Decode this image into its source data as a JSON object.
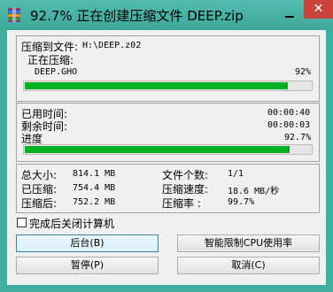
{
  "window": {
    "title": "92.7% 正在创建压缩文件 DEEP.zip",
    "close_glyph": "✕"
  },
  "file_group": {
    "compress_to_label": "压缩到文件:",
    "compress_to_value": "H:\\DEEP.z02",
    "compressing_label": "正在压缩:",
    "current_file": "DEEP.GHO",
    "file_percent": "92%",
    "file_progress": 0.92
  },
  "time_group": {
    "elapsed_label": "已用时间:",
    "elapsed_value": "00:00:40",
    "remaining_label": "剩余时间:",
    "remaining_value": "00:00:03",
    "progress_label": "进度",
    "progress_value": "92.7%",
    "overall_progress": 0.927
  },
  "stats": {
    "total_size_label": "总大小:",
    "total_size_value": "814.1 MB",
    "compressed_label": "已压缩:",
    "compressed_value": "754.4 MB",
    "after_label": "压缩后:",
    "after_value": "752.2 MB",
    "file_count_label": "文件个数:",
    "file_count_value": "1/1",
    "speed_label": "压缩速度:",
    "speed_value": "18.6 MB/秒",
    "ratio_label": "压缩率   :",
    "ratio_value": "99.7%"
  },
  "options": {
    "shutdown_label": "完成后关闭计算机",
    "shutdown_checked": false
  },
  "buttons": {
    "background": "后台(B)",
    "smart_cpu": "智能限制CPU使用率",
    "pause": "暂停(P)",
    "cancel": "取消(C)"
  },
  "colors": {
    "progress": "#06b025",
    "titlebar": "#3fae9f"
  }
}
